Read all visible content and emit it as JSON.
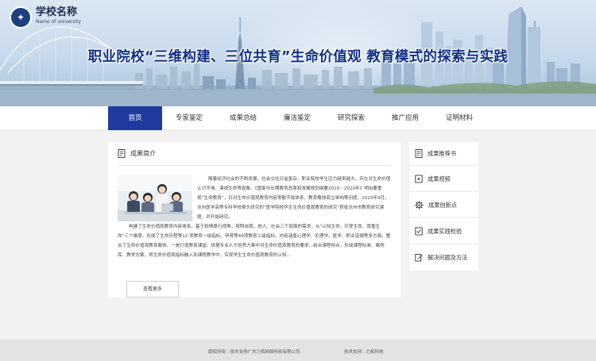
{
  "header": {
    "logo_name": "学校名称",
    "logo_subtitle": "Name of university",
    "headline": "职业院校“三维构建、三位共育”生命价值观 教育模式的探索与实践"
  },
  "nav": {
    "items": [
      {
        "label": "首页",
        "active": true
      },
      {
        "label": "专家鉴定",
        "active": false
      },
      {
        "label": "成果总结",
        "active": false
      },
      {
        "label": "廉洁鉴定",
        "active": false
      },
      {
        "label": "研究探索",
        "active": false
      },
      {
        "label": "推广应用",
        "active": false
      },
      {
        "label": "证明材料",
        "active": false
      }
    ],
    "active_color": "#1f3aa0"
  },
  "main": {
    "section_title": "成果简介",
    "icon": "document-icon",
    "paragraph1": "随着经济社会的不断发展，社会交往日益复杂，职业院校学生压力越来越大，存在对生命价值认识不清、漠视生命等现象。《国家中长期教育改革和发展规划纲要2010 - 2020年》明出要重视“生命教育”，针对生命价值观教育内容零散不成体系、教育载体孤立单纯等问题，2015年9月，沧州医学高等专科学校牵头研究的“医学院校学生生命价值观教育的研究”获批沧州市教育研究课题，并开始研究。",
    "paragraph2": "构建了生命价值观教育内容体系。基于和情景行视角，按照自我、他人、社会三个层面的需求，从“认知生命、珍爱生命、尊重生命”三个维度，形成了生命历程等12 项教育一级指标，孕育等40项教育二级指标，内容涵盖心理学、伦理学、医学、职业道德等多方面。整合了生命价值观教育载体。一是打造教育课堂。依据专业人才培养方案中对生命价值观教育的要求，结合课程特点，形成课程标准、案例库、教学方案，将生命价值观指标融入到课程教学中，实现学生生命价值观教育的认知...",
    "more_button": "查看更多"
  },
  "sidebar": {
    "items": [
      {
        "label": "成果推荐书",
        "icon": "document-icon"
      },
      {
        "label": "成果视频",
        "icon": "video-icon"
      },
      {
        "label": "成果创新点",
        "icon": "gear-icon"
      },
      {
        "label": "成果实践检验",
        "icon": "check-box-icon"
      },
      {
        "label": "解决问题及方法",
        "icon": "edit-icon"
      }
    ]
  },
  "footer": {
    "copyright": "版权所有：技术支持广东力拓网络科技有限公司",
    "tech_support": "技术支持：力拓科技"
  }
}
